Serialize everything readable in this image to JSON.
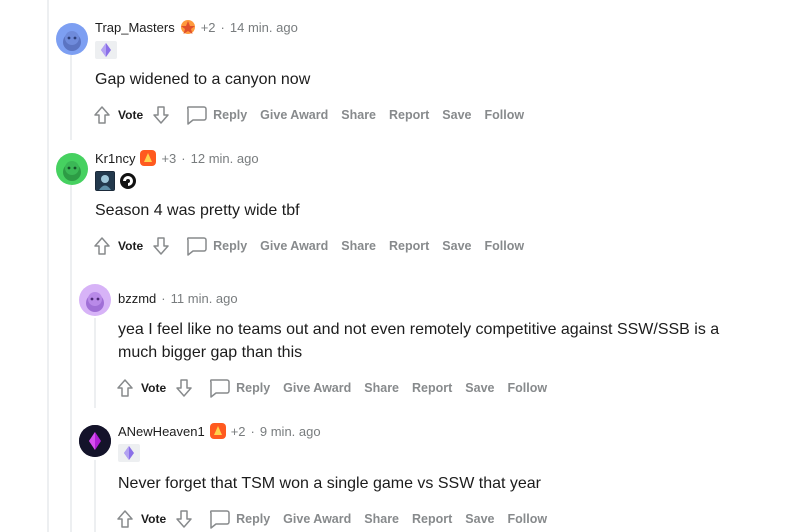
{
  "comments": [
    {
      "username": "Trap_Masters",
      "award_count": "+2",
      "separator": "·",
      "time": "14 min. ago",
      "flairs": [
        "diamond-icon"
      ],
      "text": "Gap widened to a canyon now",
      "vote_label": "Vote",
      "actions": [
        "Reply",
        "Give Award",
        "Share",
        "Report",
        "Save",
        "Follow"
      ]
    },
    {
      "username": "Kr1ncy",
      "award_count": "+3",
      "separator": "·",
      "time": "12 min. ago",
      "flairs": [
        "character-icon",
        "spiral-icon"
      ],
      "text": "Season 4 was pretty wide tbf",
      "vote_label": "Vote",
      "actions": [
        "Reply",
        "Give Award",
        "Share",
        "Report",
        "Save",
        "Follow"
      ]
    },
    {
      "username": "bzzmd",
      "separator": "·",
      "time": "11 min. ago",
      "text": "yea I feel like no teams out and not even remotely competitive against SSW/SSB is a much bigger gap than this",
      "vote_label": "Vote",
      "actions": [
        "Reply",
        "Give Award",
        "Share",
        "Report",
        "Save",
        "Follow"
      ]
    },
    {
      "username": "ANewHeaven1",
      "award_count": "+2",
      "separator": "·",
      "time": "9 min. ago",
      "flairs": [
        "diamond-icon"
      ],
      "text": "Never forget that TSM won a single game vs SSW that year",
      "vote_label": "Vote",
      "actions": [
        "Reply",
        "Give Award",
        "Share",
        "Report",
        "Save",
        "Follow"
      ]
    }
  ],
  "colors": {
    "action_grey": "#878a8c",
    "meta_grey": "#787c7e",
    "thread_line": "#edeff1",
    "avatar_blue": "#7d9ff2",
    "avatar_green": "#46d160",
    "avatar_purple": "#c18af5",
    "avatar_dark": "#1a1a2e",
    "flair_purple": "#8a6fe8"
  }
}
